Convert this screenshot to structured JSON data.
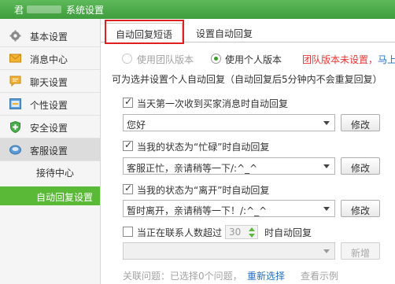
{
  "window": {
    "app_name": "君",
    "title": "系统设置"
  },
  "sidebar": {
    "items": [
      {
        "label": "基本设置",
        "icon": "gear-icon"
      },
      {
        "label": "消息中心",
        "icon": "envelope-icon"
      },
      {
        "label": "聊天设置",
        "icon": "chat-bubble-icon"
      },
      {
        "label": "个性设置",
        "icon": "personalize-icon"
      },
      {
        "label": "安全设置",
        "icon": "shield-icon"
      },
      {
        "label": "客服设置",
        "icon": "headset-icon"
      }
    ],
    "sub_items": [
      {
        "label": "接待中心"
      },
      {
        "label": "自动回复设置"
      }
    ]
  },
  "tabs": [
    {
      "label": "自动回复短语",
      "active": true
    },
    {
      "label": "设置自动回复",
      "active": false
    }
  ],
  "main": {
    "radio_team": "使用团队版本",
    "radio_personal": "使用个人版本",
    "team_notice": "团队版本未设置，",
    "team_link": "马上",
    "description": "可为选并设置个人自动回复（自动回复后5分钟内不会重复回复）",
    "rules": [
      {
        "label": "当天第一次收到买家消息时自动回复",
        "checked": true,
        "value": "您好",
        "button": "修改"
      },
      {
        "label": "当我的状态为“忙碌”时自动回复",
        "checked": true,
        "value": "客服正忙，亲请稍等一下/:^_^",
        "button": "修改"
      },
      {
        "label": "当我的状态为“离开”时自动回复",
        "checked": true,
        "value": "暂时离开，亲请稍等一下！/:^_^",
        "button": "修改"
      }
    ],
    "contact_rule": {
      "prefix": "当正在联系人数超过",
      "count": "30",
      "suffix": "时自动回复",
      "checked": false,
      "button": "新增"
    },
    "related_label": "关联问题：已选择0个问题，",
    "reselect_link": "重新选择",
    "example_link": "查看示例"
  },
  "colors": {
    "brand": "#4cae4c",
    "active_sub": "#5aba38",
    "highlight": "#e02020",
    "notice": "#e33333",
    "link": "#2270c8"
  }
}
